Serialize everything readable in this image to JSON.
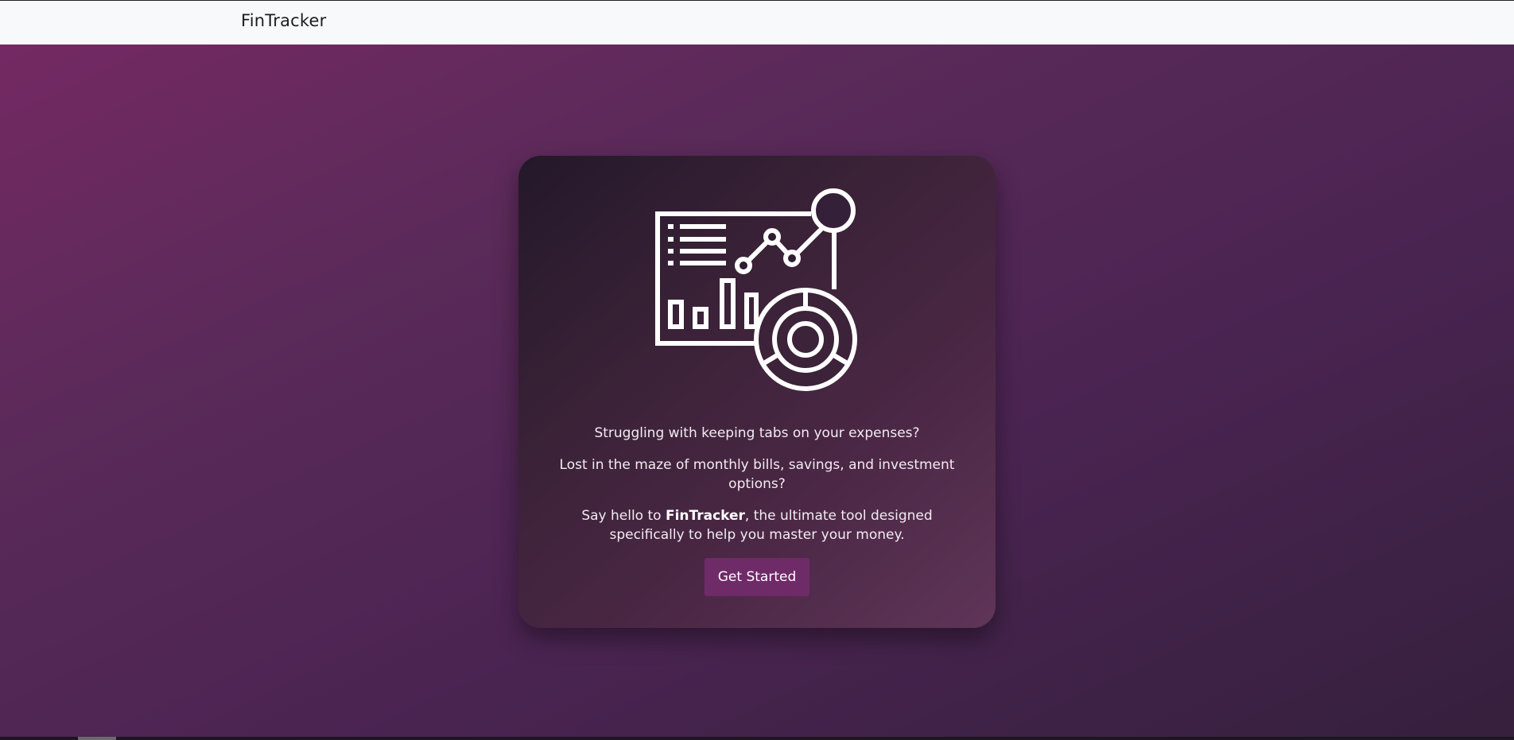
{
  "navbar": {
    "brand": "FinTracker"
  },
  "hero": {
    "icon": "financial-dashboard-icon",
    "line1": "Struggling with keeping tabs on your expenses?",
    "line2": "Lost in the maze of monthly bills, savings, and investment options?",
    "line3_prefix": "Say hello to ",
    "line3_brand": "FinTracker",
    "line3_suffix": ", the ultimate tool designed specifically to help you master your money.",
    "cta_label": "Get Started"
  },
  "colors": {
    "navbar_bg": "#f8f9fa",
    "hero_gradient_start": "#742963",
    "hero_gradient_end": "#35203d",
    "button_bg": "#6f2a68",
    "text": "#f2ecf2"
  }
}
